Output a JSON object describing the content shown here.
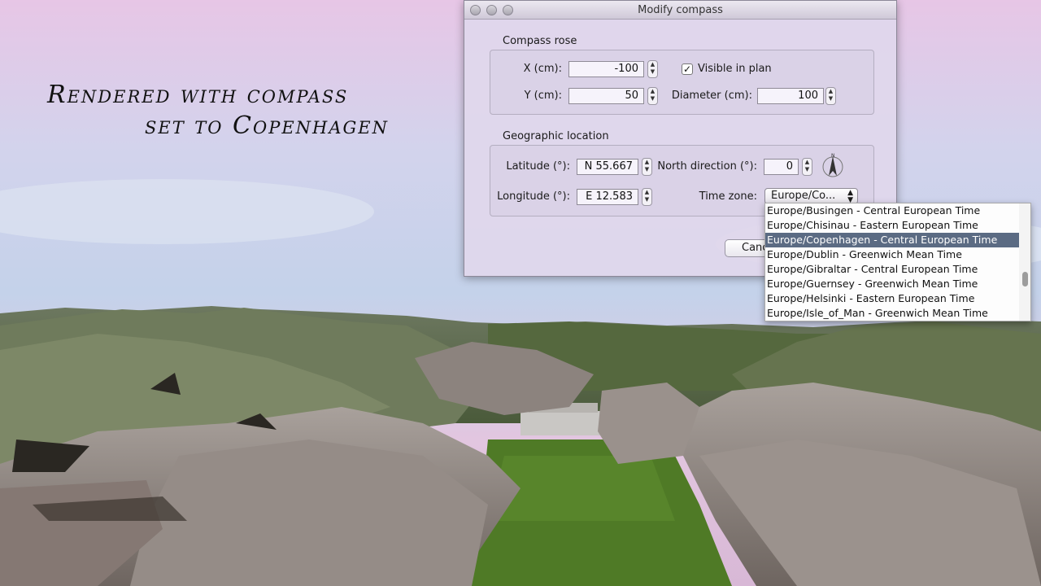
{
  "caption": {
    "line1": "Rendered with compass",
    "line2": "set to Copenhagen"
  },
  "dialog": {
    "title": "Modify compass",
    "compass_rose": {
      "label": "Compass rose",
      "x_label": "X (cm):",
      "x_value": "-100",
      "y_label": "Y (cm):",
      "y_value": "50",
      "visible_label": "Visible in plan",
      "visible_checked": true,
      "diameter_label": "Diameter (cm):",
      "diameter_value": "100"
    },
    "geo": {
      "label": "Geographic location",
      "latitude_label": "Latitude (°):",
      "latitude_value": "N 55.667",
      "longitude_label": "Longitude (°):",
      "longitude_value": "E 12.583",
      "north_label": "North direction (°):",
      "north_value": "0",
      "timezone_label": "Time zone:",
      "timezone_value": "Europe/Co..."
    },
    "cancel_label": "Canc"
  },
  "timezone_list": {
    "items": [
      "Europe/Busingen - Central European Time",
      "Europe/Chisinau - Eastern European Time",
      "Europe/Copenhagen - Central European Time",
      "Europe/Dublin - Greenwich Mean Time",
      "Europe/Gibraltar - Central European Time",
      "Europe/Guernsey - Greenwich Mean Time",
      "Europe/Helsinki - Eastern European Time",
      "Europe/Isle_of_Man - Greenwich Mean Time"
    ],
    "selected_index": 2
  },
  "icons": [
    "compass-needle-icon",
    "stepper-icon",
    "checkbox-check-icon",
    "popup-arrows-icon"
  ],
  "colors": {
    "selection": "#5b6b83",
    "sky_top": "#e9c7e6",
    "grass": "#4f7a26"
  }
}
